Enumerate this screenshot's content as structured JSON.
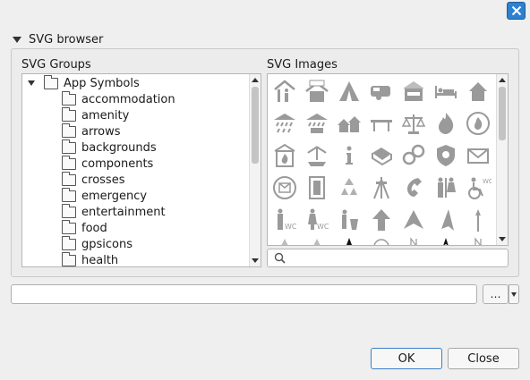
{
  "dialog": {
    "section_title": "SVG browser",
    "groups_label": "SVG Groups",
    "images_label": "SVG Images"
  },
  "tree": {
    "root": "App Symbols",
    "children": [
      "accommodation",
      "amenity",
      "arrows",
      "backgrounds",
      "components",
      "crosses",
      "emergency",
      "entertainment",
      "food",
      "gpsicons",
      "health"
    ]
  },
  "images": {
    "rows": [
      [
        "camping",
        "hostel-sign",
        "tent",
        "caravan",
        "hotel",
        "bed",
        "house"
      ],
      [
        "rain-shelter",
        "rain-shelter-2",
        "houses",
        "bench",
        "scales",
        "fire",
        "fire-badge"
      ],
      [
        "fire-station",
        "fountain",
        "information",
        "book",
        "handcuffs",
        "police-badge",
        "mail"
      ],
      [
        "postbox",
        "phone-booth",
        "recycling",
        "easel",
        "telephone",
        "toilets",
        "wheelchair-wc"
      ],
      [
        "toilets-male",
        "toilets-female",
        "toilets-waste",
        "arrow-up",
        "arrow-northeast",
        "arrow-north",
        "arrow-thin"
      ]
    ]
  },
  "search": {
    "placeholder": ""
  },
  "path": {
    "value": ""
  },
  "buttons": {
    "browse": "…",
    "ok": "OK",
    "cancel": "Close"
  }
}
